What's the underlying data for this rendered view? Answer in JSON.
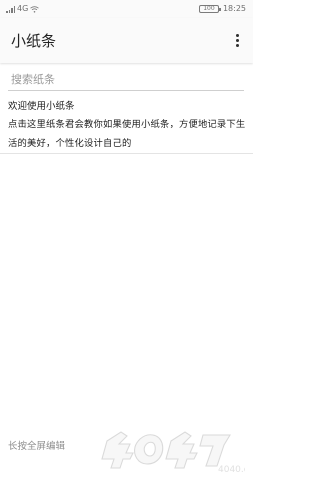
{
  "status_bar": {
    "network_label": "4G",
    "battery_level": "100",
    "time": "18:25"
  },
  "app_bar": {
    "title": "小纸条",
    "more_icon": "more-vert-icon"
  },
  "search": {
    "placeholder": "搜索纸条",
    "value": ""
  },
  "note": {
    "title": "欢迎使用小纸条",
    "body": "点击这里纸条君会教你如果使用小纸条，方便地记录下生活的美好，个性化设计自己的"
  },
  "footer": {
    "hint": "长按全屏编辑"
  },
  "watermark": {
    "text": "4040.com"
  },
  "colors": {
    "background": "#ffffff",
    "app_bar": "#fafafa",
    "text_primary": "#222222",
    "text_secondary": "#8e8e8e",
    "divider": "#d0d0d0"
  }
}
